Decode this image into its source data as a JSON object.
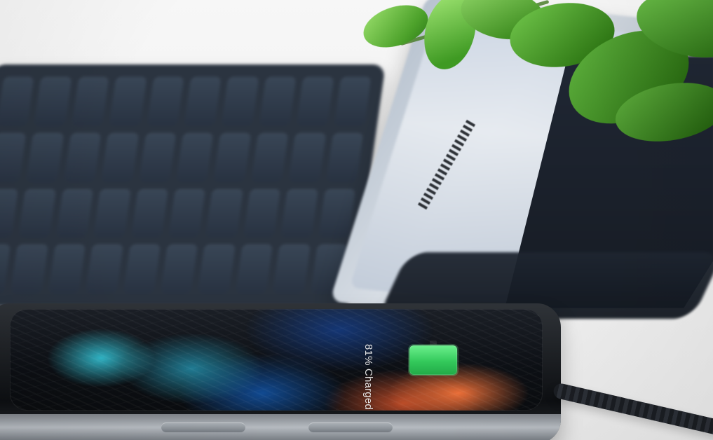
{
  "phone": {
    "charge_text": "81% Charged",
    "battery_level_percent": 81
  },
  "colors": {
    "background": "#f2f2f2",
    "battery_green": "#33c95b",
    "splash_cyan": "#37d2e6",
    "splash_orange": "#ff783c",
    "keyboard_navy": "#2b3440",
    "leaf_green": "#4ca12a"
  }
}
